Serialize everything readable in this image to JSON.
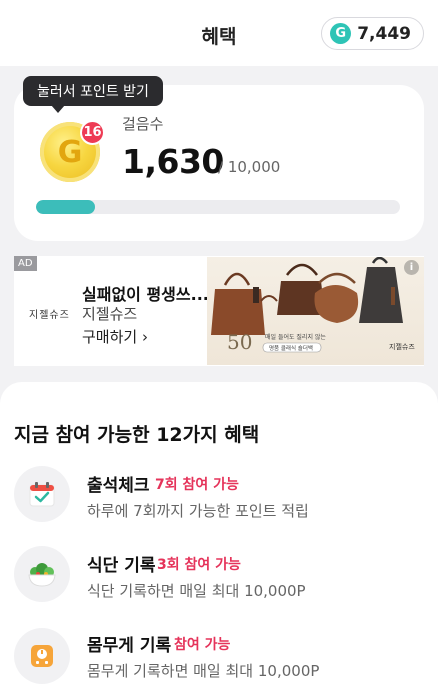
{
  "header": {
    "title": "혜택",
    "points": "7,449",
    "points_icon_letter": "G"
  },
  "steps": {
    "tooltip": "눌러서 포인트 받기",
    "coin_letter": "G",
    "coin_count": "16",
    "label": "걸음수",
    "value": "1,630",
    "goal": "/ 10,000",
    "progress_fraction": 0.163,
    "accent_color": "#3cbdba"
  },
  "ad": {
    "tag": "AD",
    "brand_mark": "지젤슈즈",
    "title": "실패없이 평생쓰...",
    "brand": "지젤슈즈",
    "cta": "구매하기 ›",
    "info_icon": "i",
    "image": {
      "percent": "50",
      "line1": "매일 들어도 질리지 않는",
      "line2": "명품 클래식 숄더백",
      "logo": "지젤슈즈"
    }
  },
  "benefits": {
    "title": "지금 참여 가능한 12가지 혜택",
    "items": [
      {
        "name": "출석체크",
        "badge": "7회 참여 가능",
        "desc": "하루에 7회까지 가능한 포인트 적립",
        "icon": "calendar-icon"
      },
      {
        "name": "식단 기록",
        "badge": "3회 참여 가능",
        "desc": "식단 기록하면 매일 최대 10,000P",
        "icon": "salad-bowl-icon"
      },
      {
        "name": "몸무게 기록",
        "badge": "참여 가능",
        "desc": "몸무게 기록하면 매일 최대 10,000P",
        "icon": "scale-icon"
      }
    ],
    "badge_color": "#e5335a"
  }
}
